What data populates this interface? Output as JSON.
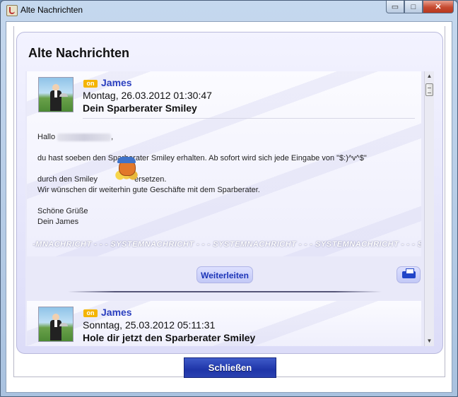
{
  "window": {
    "title": "Alte Nachrichten",
    "minimize_glyph": "▭",
    "maximize_glyph": "□",
    "close_glyph": "✕"
  },
  "panel": {
    "title": "Alte Nachrichten"
  },
  "messages": [
    {
      "status": "on",
      "sender": "James",
      "date": "Montag, 26.03.2012 01:30:47",
      "subject": "Dein Sparberater Smiley",
      "greeting": "Hallo",
      "greeting_suffix": ",",
      "line1": "du hast soeben den Sparberater Smiley erhalten. Ab sofort wird sich jede Eingabe von \"$:)^v^$\"",
      "line2_prefix": "durch den Smiley",
      "line2_suffix": "ersetzen.",
      "line3": "Wir wünschen dir weiterhin gute Geschäfte mit dem Sparberater.",
      "closing1": "Schöne Grüße",
      "closing2": "Dein James",
      "system_banner": "-MNACHRICHT - - - SYSTEMNACHRICHT - - - SYSTEMNACHRICHT - - - SYSTEMNACHRICHT - - - SYSTEMNACHRICHT"
    },
    {
      "status": "on",
      "sender": "James",
      "date": "Sonntag, 25.03.2012 05:11:31",
      "subject": "Hole dir jetzt den Sparberater Smiley"
    }
  ],
  "actions": {
    "forward_label": "Weiterleiten",
    "close_label": "Schließen"
  },
  "icons": {
    "print": "printer-icon",
    "scroll_up": "▲",
    "scroll_down": "▼"
  }
}
